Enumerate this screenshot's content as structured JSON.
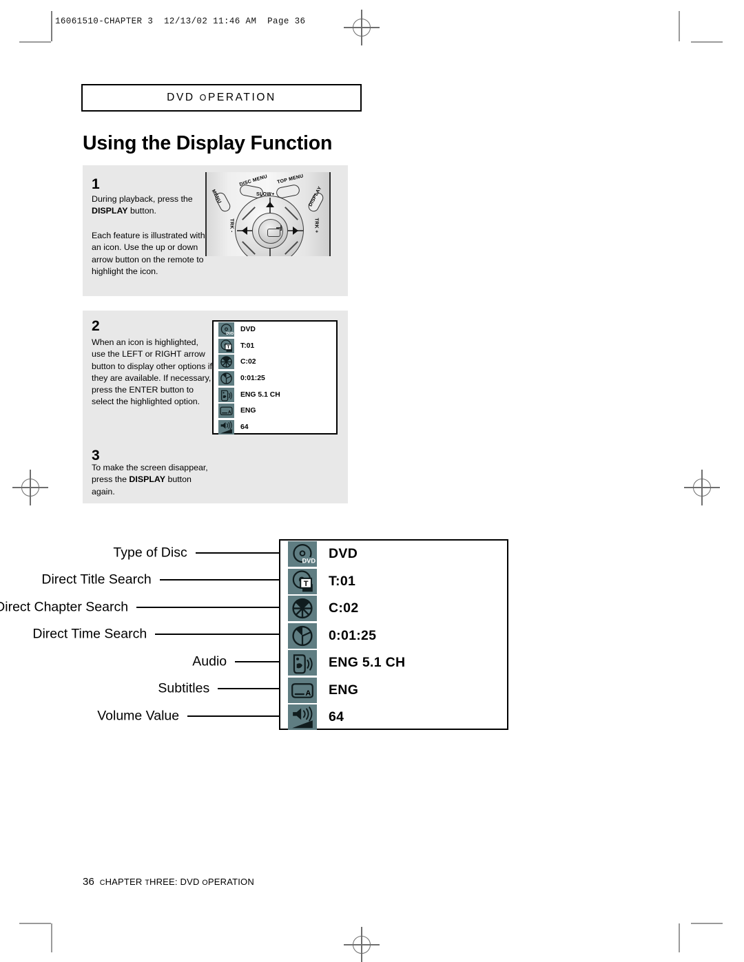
{
  "print_marks": {
    "slug": "16061510-CHAPTER 3  12/13/02 11:46 AM  Page 36"
  },
  "header": {
    "section": "DVD Operation"
  },
  "title": "Using the Display Function",
  "steps": [
    {
      "number": "1",
      "paragraphs": [
        "During playback, press the DISPLAY button.",
        "Each feature is illustrated with an icon. Use the up or down arrow button on the remote to highlight the icon."
      ]
    },
    {
      "number": "2",
      "paragraphs": [
        "When an icon is highlighted, use the LEFT or RIGHT arrow button to display other options if they are available. If necessary, press the ENTER button to select the highlighted option."
      ]
    },
    {
      "number": "3",
      "paragraphs": [
        "To make the screen disappear, press the DISPLAY button again."
      ]
    }
  ],
  "remote": {
    "buttons": [
      "MENU",
      "DISC MENU",
      "TOP MENU",
      "DISPLAY",
      "SLOW+",
      "TRK -",
      "TRK +"
    ]
  },
  "osd": {
    "rows": [
      {
        "icon": "disc-dvd-icon",
        "value": "DVD",
        "label": "Type of Disc"
      },
      {
        "icon": "disc-title-icon",
        "value": "T:01",
        "label": "Direct Title Search"
      },
      {
        "icon": "chapter-wheel-icon",
        "value": "C:02",
        "label": "Direct Chapter Search"
      },
      {
        "icon": "clock-icon",
        "value": "0:01:25",
        "label": "Direct Time Search"
      },
      {
        "icon": "audio-speech-icon",
        "value": "ENG 5.1 CH",
        "label": "Audio"
      },
      {
        "icon": "subtitle-icon",
        "value": "ENG",
        "label": "Subtitles"
      },
      {
        "icon": "volume-icon",
        "value": "64",
        "label": "Volume Value"
      }
    ]
  },
  "footer": {
    "page": "36",
    "text": "Chapter Three: DVD Operation"
  },
  "colors": {
    "icon_background": "#5f7d82",
    "panel_background": "#e8e8e8",
    "ink": "#000000"
  }
}
